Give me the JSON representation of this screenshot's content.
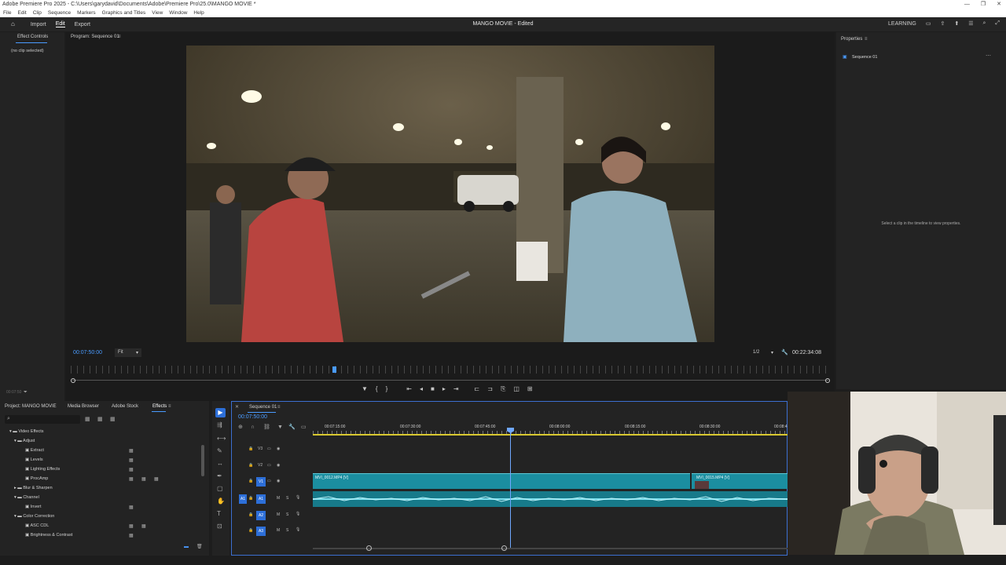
{
  "window": {
    "title": "Adobe Premiere Pro 2025 - C:\\Users\\garydavid\\Documents\\Adobe\\Premiere Pro\\25.0\\MANGO MOVIE *"
  },
  "menu": [
    "File",
    "Edit",
    "Clip",
    "Sequence",
    "Markers",
    "Graphics and Titles",
    "View",
    "Window",
    "Help"
  ],
  "workspaces": {
    "import": "Import",
    "edit": "Edit",
    "export": "Export",
    "project_status": "MANGO MOVIE - Edited",
    "learning": "LEARNING"
  },
  "effect_controls": {
    "tab": "Effect Controls",
    "no_clip": "(no clip selected)",
    "time": "00:07:50"
  },
  "program_monitor": {
    "tab": "Program: Sequence 01",
    "timecode": "00:07:50:00",
    "fit": "Fit",
    "resolution": "1/2",
    "duration": "00:22:34:08"
  },
  "properties": {
    "tab": "Properties",
    "sequence": "Sequence 01",
    "hint": "Select a clip in the timeline to view properties."
  },
  "project_panel": {
    "tabs": [
      "Project: MANGO MOVIE",
      "Media Browser",
      "Adobe Stock",
      "Effects"
    ],
    "tree": [
      {
        "label": "Video Effects",
        "level": 0
      },
      {
        "label": "Adjust",
        "level": 1
      },
      {
        "label": "Extract",
        "level": 2
      },
      {
        "label": "Levels",
        "level": 2
      },
      {
        "label": "Lighting Effects",
        "level": 2
      },
      {
        "label": "ProcAmp",
        "level": 2
      },
      {
        "label": "Blur & Sharpen",
        "level": 1
      },
      {
        "label": "Channel",
        "level": 1
      },
      {
        "label": "Invert",
        "level": 2
      },
      {
        "label": "Color Correction",
        "level": 1
      },
      {
        "label": "ASC CDL",
        "level": 2
      },
      {
        "label": "Brightness & Contrast",
        "level": 2
      }
    ]
  },
  "timeline": {
    "tab": "Sequence 01",
    "timecode": "00:07:50:00",
    "ruler": [
      "00:07:15:00",
      "00:07:30:00",
      "00:07:45:00",
      "00:08:00:00",
      "00:08:15:00",
      "00:08:30:00",
      "00:08:4"
    ],
    "tracks": [
      "V3",
      "V2",
      "V1",
      "A1",
      "A2",
      "A3"
    ],
    "clips": [
      "MVI_0012.MP4 [V]",
      "MVI_0015.MP4 [V]"
    ]
  },
  "colors": {
    "accent": "#4a9bff",
    "clip_video": "#1b8ea0",
    "clip_audio": "#177a8a",
    "playhead": "#6fa8ff"
  }
}
